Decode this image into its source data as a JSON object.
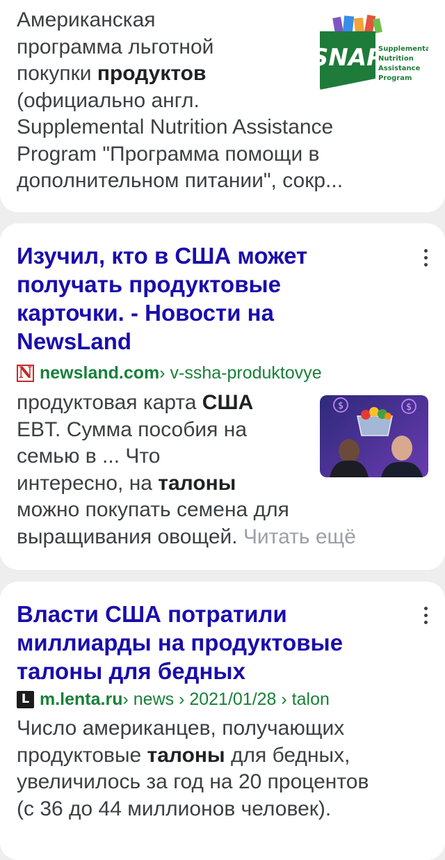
{
  "results": [
    {
      "snippet_lines": [
        [
          {
            "t": "Американская"
          }
        ],
        [
          {
            "t": "программа льготной"
          }
        ],
        [
          {
            "t": "покупки "
          },
          {
            "t": "продуктов",
            "b": true
          }
        ],
        [
          {
            "t": "(официально англ."
          }
        ],
        [
          {
            "t": "Supplemental Nutrition Assistance"
          }
        ],
        [
          {
            "t": "Program \"Программа помощи в"
          }
        ],
        [
          {
            "t": "дополнительном питании\", сокр..."
          }
        ]
      ],
      "thumbnail": {
        "logo_text": "SNAP",
        "logo_side_lines": [
          "Supplemental",
          "Nutrition",
          "Assistance",
          "Program"
        ],
        "colors": {
          "green": "#1e7b3a",
          "accent": "#f2a33a"
        }
      }
    },
    {
      "title_lines": [
        "Изучил, кто в США может",
        "получать продуктовые",
        "карточки. - Новости на",
        "NewsLand"
      ],
      "favicon_letter": "N",
      "url_domain": "newsland.com",
      "url_path": " › v-ssha-produktovye",
      "snippet_lines": [
        [
          {
            "t": "продуктовая карта "
          },
          {
            "t": "США",
            "b": true
          }
        ],
        [
          {
            "t": "EBT. Сумма пособия на"
          }
        ],
        [
          {
            "t": "семью в ... Что"
          }
        ],
        [
          {
            "t": "интересно, на "
          },
          {
            "t": "талоны",
            "b": true
          }
        ],
        [
          {
            "t": "можно покупать семена для"
          }
        ],
        [
          {
            "t": "выращивания овощей. "
          },
          {
            "t": "Читать ещё",
            "more": true
          }
        ]
      ],
      "menu_icon": "more-vert-icon"
    },
    {
      "title_lines": [
        "Власти США потратили",
        "миллиарды на продуктовые",
        "талоны для бедных"
      ],
      "favicon_letter": "L",
      "url_domain": "m.lenta.ru",
      "url_path": " › news › 2021/01/28 › talon",
      "snippet_lines": [
        [
          {
            "t": "Число американцев, получающих"
          }
        ],
        [
          {
            "t": "продуктовые "
          },
          {
            "t": "талоны",
            "b": true
          },
          {
            "t": " для бедных,"
          }
        ],
        [
          {
            "t": "увеличилось за год на 20 процентов"
          }
        ],
        [
          {
            "t": "(с 36 до 44 миллионов человек)."
          }
        ]
      ],
      "menu_icon": "more-vert-icon"
    }
  ],
  "colors": {
    "title_link": "#1a0dab",
    "url_green": "#188038",
    "snippet_text": "#3c4043",
    "background": "#eeeeee"
  }
}
